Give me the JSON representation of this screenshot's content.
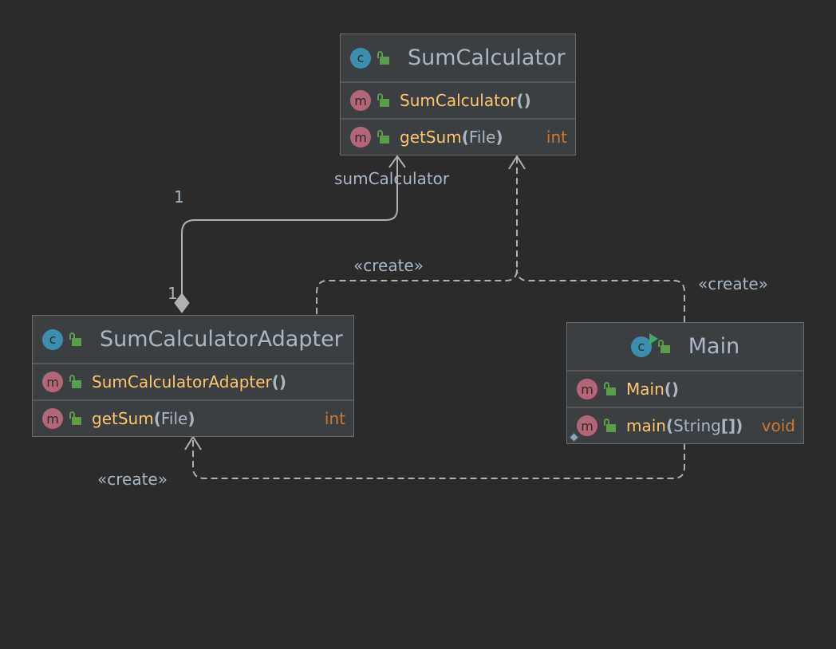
{
  "classes": {
    "sum_calculator": {
      "badge": "c",
      "name": "SumCalculator",
      "members": [
        {
          "badge": "m",
          "name": "SumCalculator",
          "open": "(",
          "params": "",
          "close": ")",
          "return": ""
        },
        {
          "badge": "m",
          "name": "getSum",
          "open": "(",
          "params": "File",
          "close": ")",
          "return": "int"
        }
      ]
    },
    "adapter": {
      "badge": "c",
      "name": "SumCalculatorAdapter",
      "members": [
        {
          "badge": "m",
          "name": "SumCalculatorAdapter",
          "open": "(",
          "params": "",
          "close": ")",
          "return": ""
        },
        {
          "badge": "m",
          "name": "getSum",
          "open": "(",
          "params": "File",
          "close": ")",
          "return": "int"
        }
      ]
    },
    "main": {
      "badge": "c",
      "name": "Main",
      "members": [
        {
          "badge": "m",
          "name": "Main",
          "open": "(",
          "params": "",
          "close": ")",
          "return": ""
        },
        {
          "badge": "m",
          "name": "main",
          "open": "(",
          "params": "String",
          "close": "[])",
          "return": "void"
        }
      ]
    }
  },
  "edges": {
    "composition": {
      "role": "sumCalculator",
      "multiplicity_target": "1",
      "multiplicity_source": "1"
    },
    "create_adapter_to_calculator": "«create»",
    "create_main_to_calculator": "«create»",
    "create_main_to_adapter": "«create»"
  },
  "icons": {
    "class_badge": "class-icon",
    "method_badge": "method-icon",
    "visibility": "public-lock-icon",
    "run_marker": "run-icon",
    "static_marker": "static-icon"
  },
  "colors": {
    "background": "#2b2b2b",
    "node_fill": "#3c3f41",
    "method_name": "#ffc66d",
    "return_type": "#cc7832",
    "text": "#a9b7c6",
    "class_badge": "#3c8dae",
    "method_badge": "#b26678",
    "lock": "#5a9e4c",
    "edge": "#b0b0b0"
  }
}
